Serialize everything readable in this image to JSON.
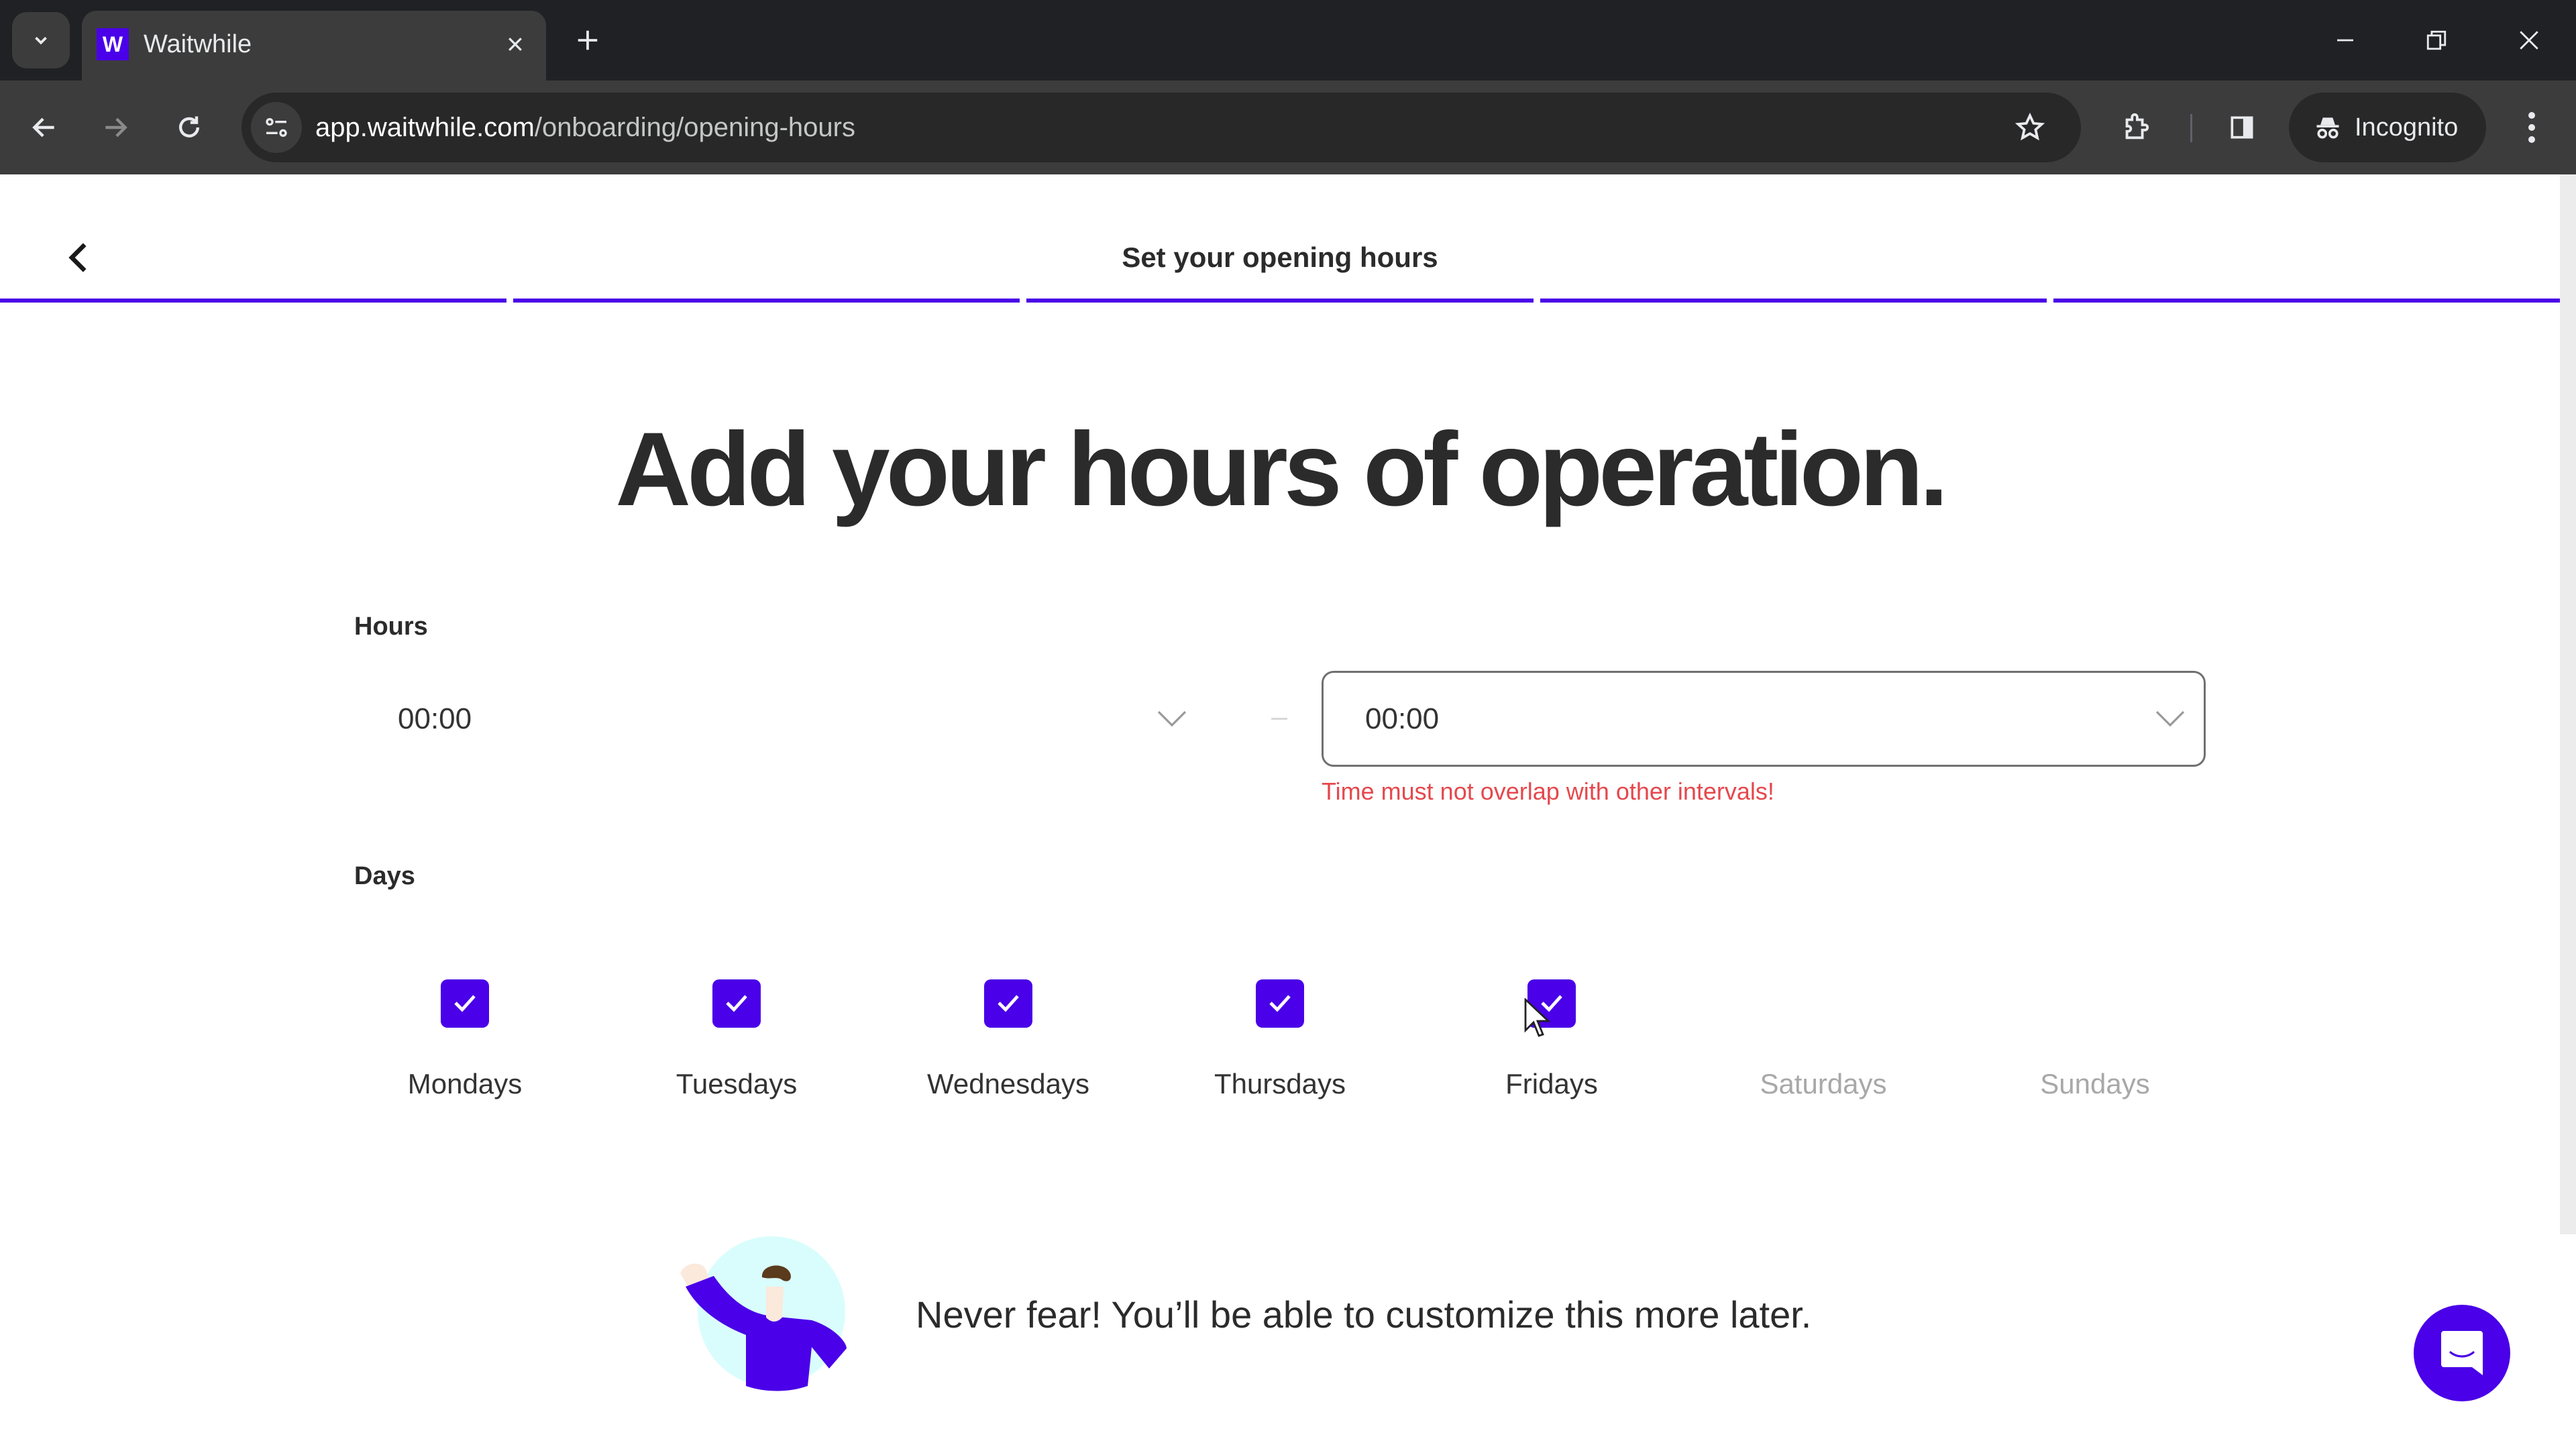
{
  "browser": {
    "tab_title": "Waitwhile",
    "favicon_letter": "W",
    "url_host": "app.waitwhile.com",
    "url_path": "/onboarding/opening-hours",
    "profile_label": "Incognito",
    "icons": {
      "tab_search": "chevron-down-icon",
      "tab_close": "close-icon",
      "new_tab": "plus-icon",
      "minimize": "minimize-icon",
      "restore": "restore-icon",
      "close_window": "close-icon",
      "back": "arrow-left-icon",
      "forward": "arrow-right-icon",
      "reload": "reload-icon",
      "site_info": "tune-icon",
      "bookmark": "star-icon",
      "extensions": "puzzle-icon",
      "side_panel": "side-panel-icon",
      "incognito": "incognito-icon",
      "menu": "more-vertical-icon"
    }
  },
  "header": {
    "title": "Set your opening hours",
    "back_icon": "chevron-left-icon",
    "progress": {
      "total_steps": 5,
      "segments_filled": [
        1,
        1,
        1,
        1,
        1
      ]
    }
  },
  "main": {
    "heading": "Add your hours of operation.",
    "hours": {
      "label": "Hours",
      "start_value": "00:00",
      "end_value": "00:00",
      "separator": "-",
      "error": "Time must not overlap with other intervals!"
    },
    "days": {
      "label": "Days",
      "items": [
        {
          "label": "Mondays",
          "checked": true
        },
        {
          "label": "Tuesdays",
          "checked": true
        },
        {
          "label": "Wednesdays",
          "checked": true
        },
        {
          "label": "Thursdays",
          "checked": true
        },
        {
          "label": "Fridays",
          "checked": true
        },
        {
          "label": "Saturdays",
          "checked": false
        },
        {
          "label": "Sundays",
          "checked": false
        }
      ]
    },
    "note": "Never fear! You’ll be able to customize this more later."
  },
  "colors": {
    "brand": "#4a00e8",
    "error": "#e5484d",
    "text": "#2b2b2b",
    "muted": "#a8a8a8"
  }
}
